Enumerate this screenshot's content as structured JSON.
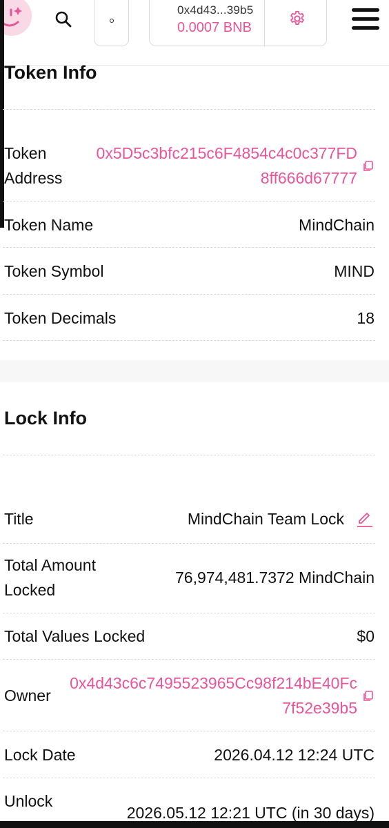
{
  "header": {
    "wallet_address": "0x4d43...39b5",
    "wallet_balance": "0.0007 BNB",
    "icons": {
      "logo": "mascot-logo",
      "search": "search-icon",
      "chain": "chain-icon",
      "settings": "gear-icon",
      "menu": "hamburger-icon"
    }
  },
  "token_info": {
    "title": "Token Info",
    "rows": {
      "address_label": "Token Address",
      "address_value": "0x5D5c3bfc215c6F4854c4c0c377FD8ff666d67777",
      "name_label": "Token Name",
      "name_value": "MindChain",
      "symbol_label": "Token Symbol",
      "symbol_value": "MIND",
      "decimals_label": "Token Decimals",
      "decimals_value": "18"
    }
  },
  "lock_info": {
    "title": "Lock Info",
    "rows": {
      "title_label": "Title",
      "title_value": "MindChain Team Lock",
      "amount_label": "Total Amount Locked",
      "amount_value": "76,974,481.7372 MindChain",
      "values_label": "Total Values Locked",
      "values_value": "$0",
      "owner_label": "Owner",
      "owner_value": "0x4d43c6c7495523965Cc98f214bE40Fc7f52e39b5",
      "lock_date_label": "Lock Date",
      "lock_date_value": "2026.04.12 12:24 UTC",
      "unlock_label": "Unlock",
      "unlock_value": "2026.05.12 12:21 UTC (in 30 days)"
    }
  },
  "colors": {
    "accent": "#e8559a",
    "text": "#111111",
    "divider": "#d8d8d8"
  }
}
